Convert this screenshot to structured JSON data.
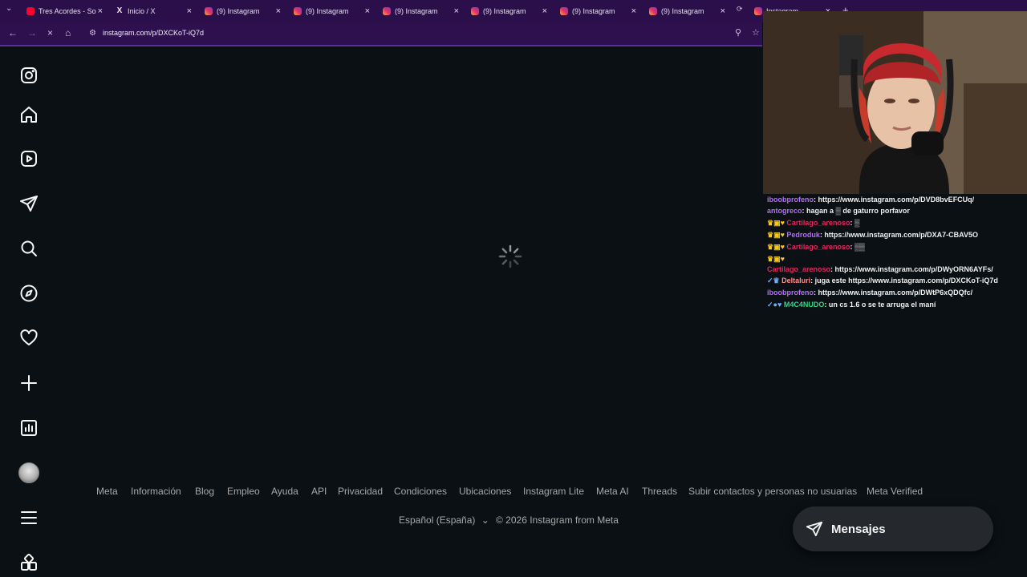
{
  "tabs": [
    {
      "label": "Tres Acordes - So",
      "icon": "youtube-icon"
    },
    {
      "label": "Inicio / X",
      "icon": "x-logo-icon"
    },
    {
      "label": "(9) Instagram",
      "icon": "instagram-icon"
    },
    {
      "label": "(9) Instagram",
      "icon": "instagram-icon"
    },
    {
      "label": "(9) Instagram",
      "icon": "instagram-icon"
    },
    {
      "label": "(9) Instagram",
      "icon": "instagram-icon"
    },
    {
      "label": "(9) Instagram",
      "icon": "instagram-icon"
    },
    {
      "label": "(9) Instagram",
      "icon": "instagram-icon"
    },
    {
      "label": "Instagram",
      "icon": "instagram-icon"
    }
  ],
  "address_bar": {
    "url": "instagram.com/p/DXCKoT-iQ7d"
  },
  "sidebar": [
    "instagram-logo",
    "home",
    "reels",
    "messages",
    "search",
    "explore",
    "notifications",
    "create",
    "dashboard",
    "profile",
    "more",
    "also-from-meta"
  ],
  "footer": {
    "links": [
      "Meta",
      "Información",
      "Blog",
      "Empleo",
      "Ayuda",
      "API",
      "Privacidad",
      "Condiciones",
      "Ubicaciones",
      "Instagram Lite",
      "Meta AI",
      "Threads",
      "Subir contactos y personas no usuarias",
      "Meta Verified"
    ],
    "language": "Español (España)",
    "copyright": "© 2026 Instagram from Meta"
  },
  "messages_button": {
    "label": "Mensajes"
  },
  "chat": [
    {
      "user": "iboobprofeno",
      "color": "#b56bff",
      "text": ": https://www.instagram.com/p/DVD8bvEFCUq/"
    },
    {
      "user": "antogreco",
      "color": "#b56bff",
      "text": ": hagan a ▒ de gaturro porfavor"
    },
    {
      "user": "Cartilago_arenoso",
      "color": "#e0245e",
      "text": ": ▒"
    },
    {
      "user": "Pedroduk",
      "color": "#b56bff",
      "text": ": https://www.instagram.com/p/DXA7-CBAV5O"
    },
    {
      "user": "Cartilago_arenoso",
      "color": "#e0245e",
      "text": ": ▒▒"
    },
    {
      "user": "Cartilago_arenoso",
      "color": "#e0245e",
      "text": ": https://www.instagram.com/p/DWyORN6AYFs/"
    },
    {
      "user": "Deltaluri",
      "color": "#ff8c8c",
      "text": ": juga este https://www.instagram.com/p/DXCKoT-iQ7d"
    },
    {
      "user": "iboobprofeno",
      "color": "#b56bff",
      "text": ": https://www.instagram.com/p/DWtP6xQDQfc/"
    },
    {
      "user": "M4C4NUDO",
      "color": "#2fd58a",
      "text": ": un cs 1.6 o se te arruga el maní"
    }
  ]
}
